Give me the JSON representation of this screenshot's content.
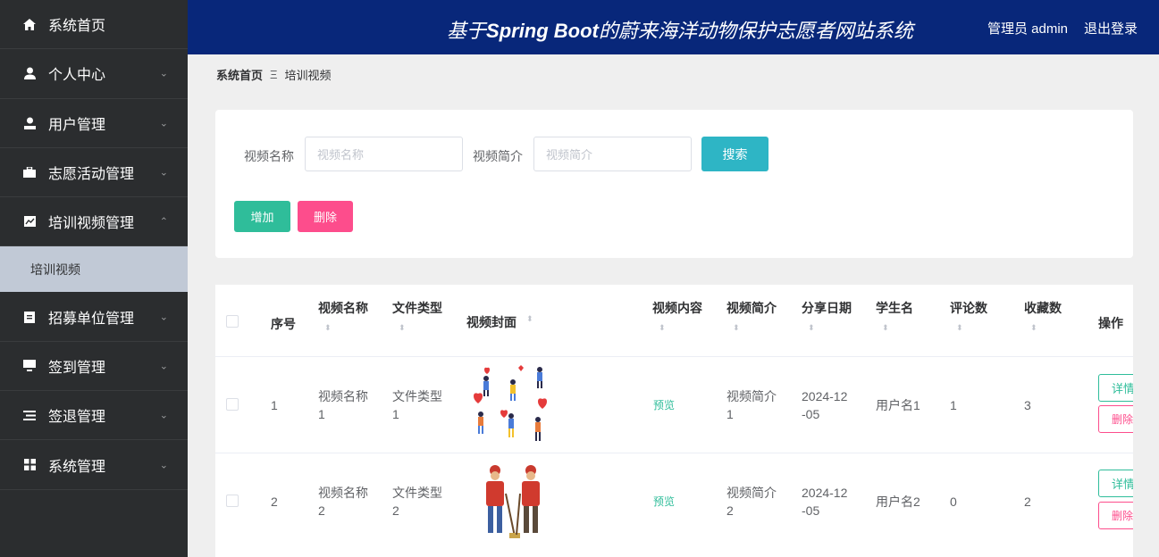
{
  "sidebar": {
    "items": [
      {
        "label": "系统首页",
        "icon": "home-icon",
        "chevron": ""
      },
      {
        "label": "个人中心",
        "icon": "user-icon",
        "chevron": "⌄"
      },
      {
        "label": "用户管理",
        "icon": "user-icon",
        "chevron": "⌄"
      },
      {
        "label": "志愿活动管理",
        "icon": "briefcase-icon",
        "chevron": "⌄"
      },
      {
        "label": "培训视频管理",
        "icon": "chart-icon",
        "chevron": "⌃"
      },
      {
        "label": "招募单位管理",
        "icon": "clipboard-icon",
        "chevron": "⌄"
      },
      {
        "label": "签到管理",
        "icon": "monitor-icon",
        "chevron": "⌄"
      },
      {
        "label": "签退管理",
        "icon": "list-icon",
        "chevron": "⌄"
      },
      {
        "label": "系统管理",
        "icon": "grid-icon",
        "chevron": "⌄"
      }
    ],
    "sub_item": "培训视频"
  },
  "header": {
    "title_bold": "Spring Boot",
    "title_prefix": "基于",
    "title_suffix": "的蔚来海洋动物保护志愿者网站系统",
    "user": "管理员 admin",
    "logout": "退出登录"
  },
  "breadcrumb": {
    "home": "系统首页",
    "separator": "Ξ",
    "current": "培训视频"
  },
  "search": {
    "name_label": "视频名称",
    "name_placeholder": "视频名称",
    "intro_label": "视频简介",
    "intro_placeholder": "视频简介",
    "search_button": "搜索",
    "add_button": "增加",
    "delete_button": "删除"
  },
  "table": {
    "headers": [
      "序号",
      "视频名称",
      "文件类型",
      "视频封面",
      "视频内容",
      "视频简介",
      "分享日期",
      "学生名",
      "评论数",
      "收藏数",
      "操作"
    ],
    "rows": [
      {
        "index": "1",
        "name_1": "视频名称",
        "name_2": "1",
        "type_1": "文件类型",
        "type_2": "1",
        "content": "预览",
        "intro_1": "视频简介",
        "intro_2": "1",
        "date_1": "2024-12",
        "date_2": "-05",
        "student": "用户名1",
        "comments": "1",
        "favorites": "3",
        "detail": "详情",
        "delete": "删除"
      },
      {
        "index": "2",
        "name_1": "视频名称",
        "name_2": "2",
        "type_1": "文件类型",
        "type_2": "2",
        "content": "预览",
        "intro_1": "视频简介",
        "intro_2": "2",
        "date_1": "2024-12",
        "date_2": "-05",
        "student": "用户名2",
        "comments": "0",
        "favorites": "2",
        "detail": "详情",
        "delete": "删除"
      }
    ]
  },
  "colors": {
    "sidebar_bg": "#2b2d2f",
    "header_bg": "#08277a",
    "primary": "#2fbd9a",
    "danger": "#fd4d8c",
    "search": "#2eb5c5"
  }
}
